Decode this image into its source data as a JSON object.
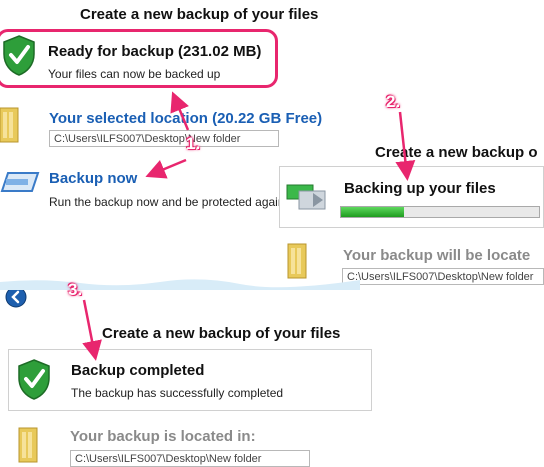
{
  "panel1": {
    "title": "Create a new backup of your files",
    "status_title": "Ready for backup (231.02 MB)",
    "status_sub": "Your files can now be backed up",
    "location_title": "Your selected location (20.22 GB Free)",
    "location_path": "C:\\Users\\ILFS007\\Desktop\\New folder",
    "backup_now_label": "Backup now",
    "backup_now_desc": "Run the backup now and be protected again"
  },
  "panel2": {
    "title": "Create a new backup o",
    "status_title": "Backing up your files",
    "progress": 0.32,
    "location_title": "Your backup will be locate",
    "location_path": "C:\\Users\\ILFS007\\Desktop\\New folder"
  },
  "panel3": {
    "title": "Create a new backup of your files",
    "status_title": "Backup completed",
    "status_sub": "The backup has successfully completed",
    "location_title": "Your backup is located in:",
    "location_path": "C:\\Users\\ILFS007\\Desktop\\New folder"
  },
  "steps": {
    "one": "1.",
    "two": "2.",
    "three": "3."
  },
  "colors": {
    "annotation": "#e8266e",
    "link": "#1a5fb4",
    "progress": "#2db52d"
  }
}
